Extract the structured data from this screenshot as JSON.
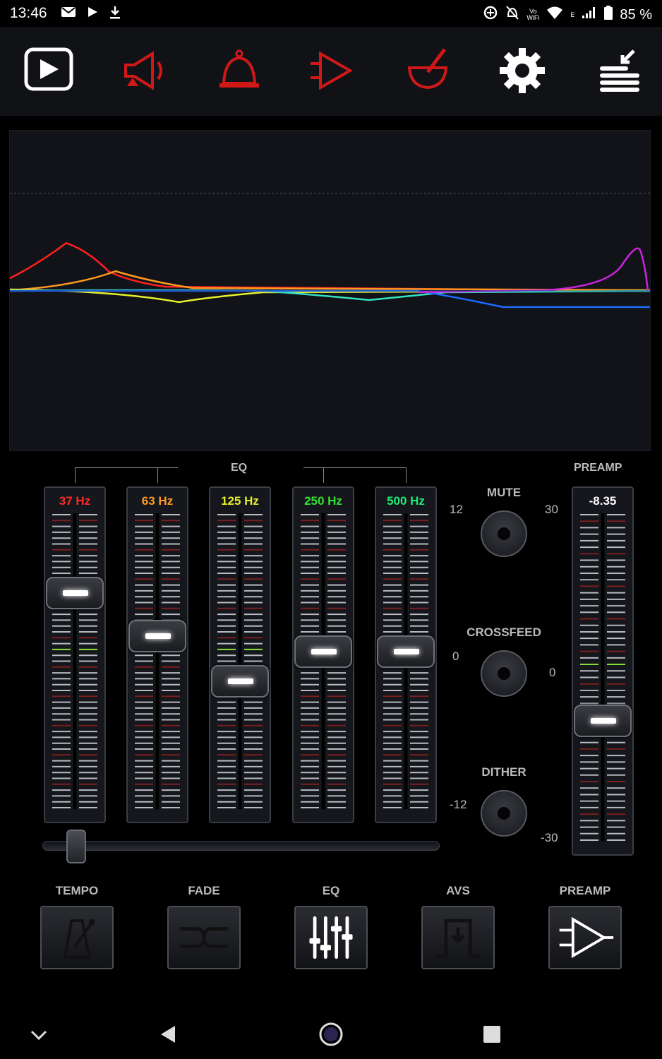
{
  "status_bar": {
    "time": "13:46",
    "left_icons": [
      "mail-icon",
      "play-icon",
      "download-icon"
    ],
    "vowifi_top": "Vo",
    "vowifi_bottom": "WiFi",
    "signal_letter": "E",
    "battery": "85 %"
  },
  "toolbar": {
    "items": [
      {
        "icon": "play-screen-icon",
        "color": "#ffffff"
      },
      {
        "icon": "speaker-icon",
        "color": "#d01818"
      },
      {
        "icon": "bell-icon",
        "color": "#d01818"
      },
      {
        "icon": "output-arrow-icon",
        "color": "#d01818"
      },
      {
        "icon": "mortar-pestle-icon",
        "color": "#d01818"
      },
      {
        "icon": "gear-icon",
        "color": "#ffffff"
      },
      {
        "icon": "queue-menu-icon",
        "color": "#ffffff"
      }
    ]
  },
  "eq": {
    "title": "EQ",
    "preamp_title": "PREAMP",
    "bands": [
      {
        "label": "37 Hz",
        "color": "#ff2a2a",
        "gain_fraction": 0.76
      },
      {
        "label": "63 Hz",
        "color": "#ff9a1f",
        "gain_fraction": 0.6
      },
      {
        "label": "125 Hz",
        "color": "#e6f02a",
        "gain_fraction": 0.43
      },
      {
        "label": "250 Hz",
        "color": "#33e233",
        "gain_fraction": 0.54
      },
      {
        "label": "500 Hz",
        "color": "#1eeb78",
        "gain_fraction": 0.54
      }
    ],
    "scale_top": "12",
    "scale_mid": "0",
    "scale_bottom": "-12",
    "preamp": {
      "value": "-8.35",
      "scale_top": "30",
      "scale_mid": "0",
      "scale_bottom": "-30",
      "level_fraction": 0.36
    }
  },
  "toggles": {
    "mute": "MUTE",
    "crossfeed": "CROSSFEED",
    "dither": "DITHER"
  },
  "tempo_slider": {
    "level_fraction": 0.06
  },
  "bottom_buttons": [
    {
      "label": "TEMPO",
      "icon": "metronome-icon"
    },
    {
      "label": "FADE",
      "icon": "crossfade-icon"
    },
    {
      "label": "EQ",
      "icon": "equalizer-icon"
    },
    {
      "label": "AVS",
      "icon": "avs-icon"
    },
    {
      "label": "PREAMP",
      "icon": "amplifier-icon"
    }
  ],
  "nav_bar": [
    "chevron-down-icon",
    "back-icon",
    "home-icon",
    "recents-icon"
  ]
}
